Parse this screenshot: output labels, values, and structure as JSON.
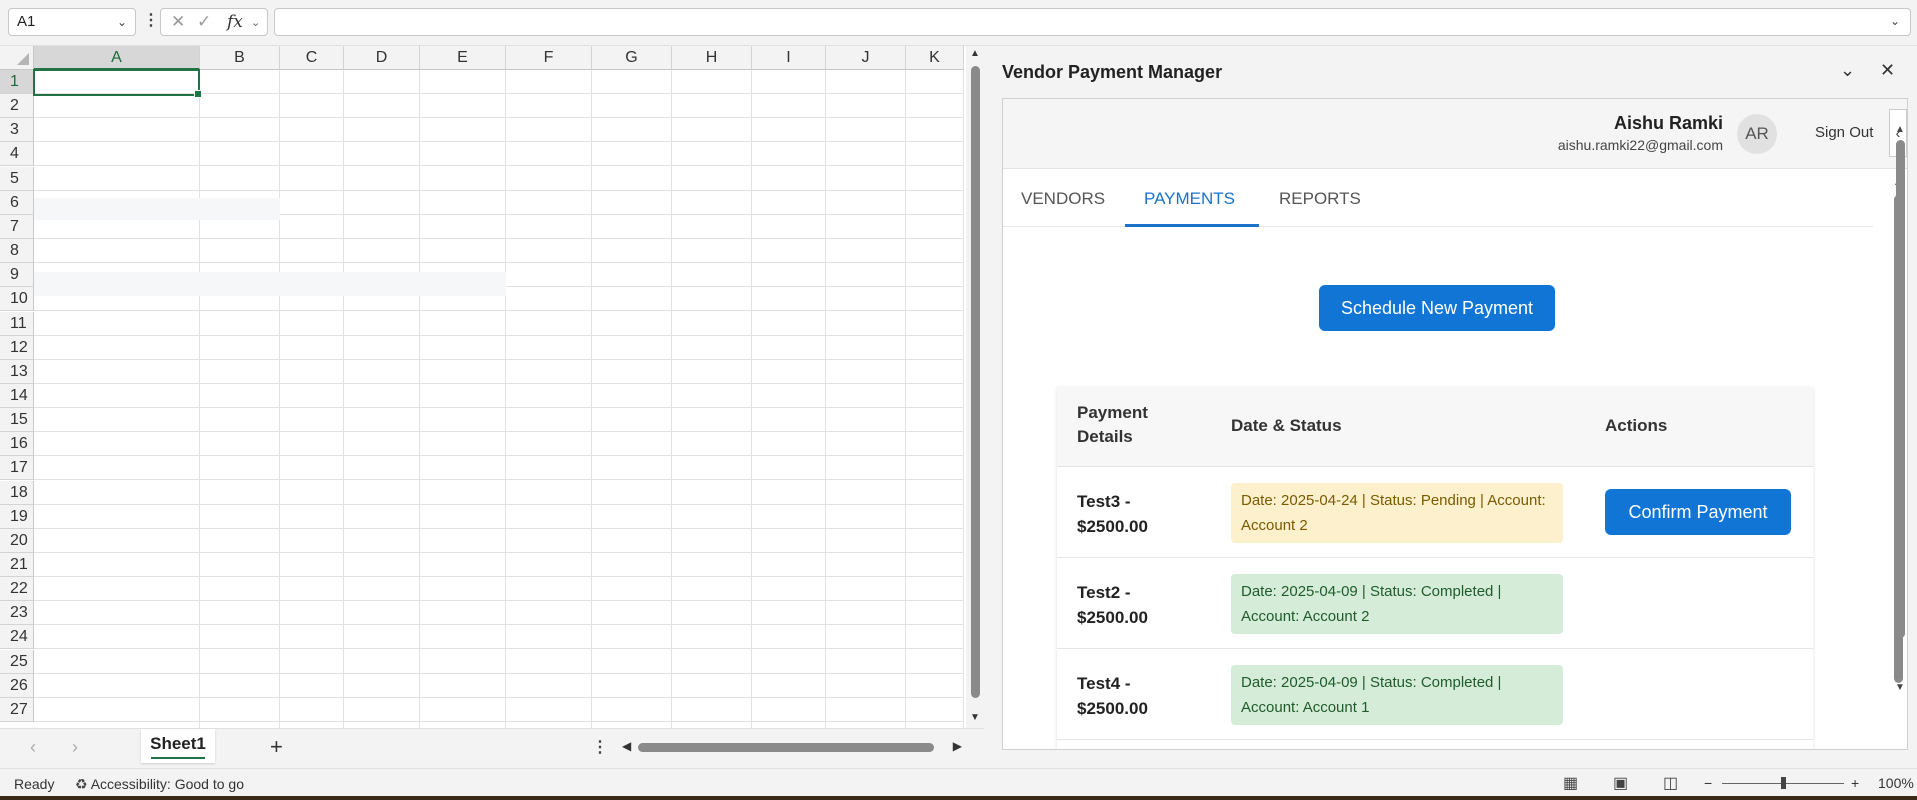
{
  "formula_bar": {
    "name_box": "A1",
    "fx_label": "fx",
    "formula_value": ""
  },
  "grid": {
    "columns": [
      "A",
      "B",
      "C",
      "D",
      "E",
      "F",
      "G",
      "H",
      "I",
      "J",
      "K"
    ],
    "rows": [
      "1",
      "2",
      "3",
      "4",
      "5",
      "6",
      "7",
      "8",
      "9",
      "10",
      "11",
      "12",
      "13",
      "14",
      "15",
      "16",
      "17",
      "18",
      "19",
      "20",
      "21",
      "22",
      "23",
      "24",
      "25",
      "26",
      "27"
    ],
    "selected_column": "A",
    "selected_row": "1"
  },
  "sheet_tabs": {
    "active": "Sheet1",
    "add_label": "+"
  },
  "status_bar": {
    "ready": "Ready",
    "accessibility": "Accessibility: Good to go",
    "zoom_minus": "−",
    "zoom_plus": "+",
    "zoom": "100%"
  },
  "pane": {
    "title": "Vendor Payment Manager",
    "user": {
      "name": "Aishu Ramki",
      "email": "aishu.ramki22@gmail.com",
      "initials": "AR",
      "sign_out": "Sign Out"
    },
    "tabs": [
      "VENDORS",
      "PAYMENTS",
      "REPORTS"
    ],
    "active_tab": "PAYMENTS",
    "schedule_button": "Schedule New Payment",
    "table": {
      "headers": [
        "Payment\nDetails",
        "Date & Status",
        "Actions"
      ],
      "rows": [
        {
          "details": "Test3 - $2500.00",
          "status": "Date: 2025-04-24 | Status: Pending | Account: Account 2",
          "state": "pending",
          "action": "Confirm Payment"
        },
        {
          "details": "Test2 - $2500.00",
          "status": "Date: 2025-04-09 | Status: Completed | Account: Account 2",
          "state": "completed",
          "action": ""
        },
        {
          "details": "Test4 - $2500.00",
          "status": "Date: 2025-04-09 | Status: Completed | Account: Account 1",
          "state": "completed",
          "action": ""
        }
      ]
    }
  },
  "colors": {
    "excel_green": "#217346",
    "accent_blue": "#1175d6",
    "pending_bg": "#fdf0cc",
    "completed_bg": "#d5ecd9"
  }
}
